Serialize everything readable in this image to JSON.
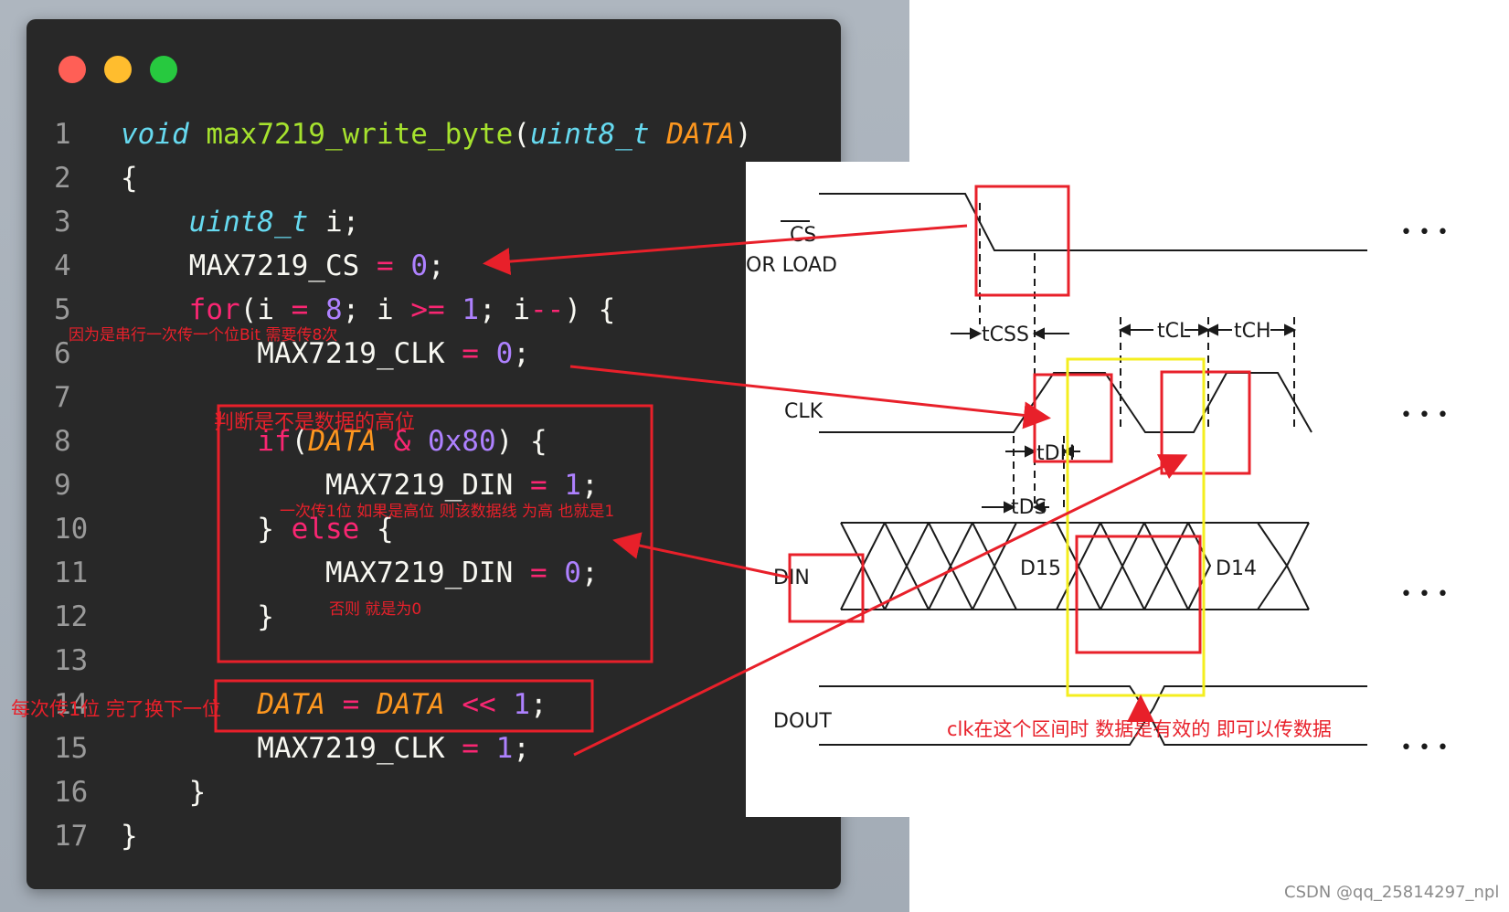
{
  "code": {
    "lines": [
      {
        "num": "1",
        "tokens": [
          [
            "kw-type",
            "void"
          ],
          [
            "plain",
            " "
          ],
          [
            "fn",
            "max7219_write_byte"
          ],
          [
            "plain",
            "("
          ],
          [
            "kw-type",
            "uint8_t"
          ],
          [
            "plain",
            " "
          ],
          [
            "param",
            "DATA"
          ],
          [
            "plain",
            ")"
          ]
        ]
      },
      {
        "num": "2",
        "tokens": [
          [
            "plain",
            "{"
          ]
        ]
      },
      {
        "num": "3",
        "tokens": [
          [
            "plain",
            "    "
          ],
          [
            "kw-type",
            "uint8_t"
          ],
          [
            "plain",
            " i;"
          ]
        ]
      },
      {
        "num": "4",
        "tokens": [
          [
            "plain",
            "    MAX7219_CS "
          ],
          [
            "op",
            "="
          ],
          [
            "plain",
            " "
          ],
          [
            "num",
            "0"
          ],
          [
            "plain",
            ";"
          ]
        ]
      },
      {
        "num": "5",
        "tokens": [
          [
            "plain",
            "    "
          ],
          [
            "kw",
            "for"
          ],
          [
            "plain",
            "(i "
          ],
          [
            "op",
            "="
          ],
          [
            "plain",
            " "
          ],
          [
            "num",
            "8"
          ],
          [
            "plain",
            "; i "
          ],
          [
            "op",
            ">="
          ],
          [
            "plain",
            " "
          ],
          [
            "num",
            "1"
          ],
          [
            "plain",
            "; i"
          ],
          [
            "op",
            "--"
          ],
          [
            "plain",
            ") {"
          ]
        ]
      },
      {
        "num": "6",
        "tokens": [
          [
            "plain",
            "        MAX7219_CLK "
          ],
          [
            "op",
            "="
          ],
          [
            "plain",
            " "
          ],
          [
            "num",
            "0"
          ],
          [
            "plain",
            ";"
          ]
        ]
      },
      {
        "num": "7",
        "tokens": []
      },
      {
        "num": "8",
        "tokens": [
          [
            "plain",
            "        "
          ],
          [
            "kw",
            "if"
          ],
          [
            "plain",
            "("
          ],
          [
            "param",
            "DATA"
          ],
          [
            "plain",
            " "
          ],
          [
            "op",
            "&"
          ],
          [
            "plain",
            " "
          ],
          [
            "num",
            "0x80"
          ],
          [
            "plain",
            ") {"
          ]
        ]
      },
      {
        "num": "9",
        "tokens": [
          [
            "plain",
            "            MAX7219_DIN "
          ],
          [
            "op",
            "="
          ],
          [
            "plain",
            " "
          ],
          [
            "num",
            "1"
          ],
          [
            "plain",
            ";"
          ]
        ]
      },
      {
        "num": "10",
        "tokens": [
          [
            "plain",
            "        } "
          ],
          [
            "kw",
            "else"
          ],
          [
            "plain",
            " {"
          ]
        ]
      },
      {
        "num": "11",
        "tokens": [
          [
            "plain",
            "            MAX7219_DIN "
          ],
          [
            "op",
            "="
          ],
          [
            "plain",
            " "
          ],
          [
            "num",
            "0"
          ],
          [
            "plain",
            ";"
          ]
        ]
      },
      {
        "num": "12",
        "tokens": [
          [
            "plain",
            "        }"
          ]
        ]
      },
      {
        "num": "13",
        "tokens": []
      },
      {
        "num": "14",
        "tokens": [
          [
            "plain",
            "        "
          ],
          [
            "param",
            "DATA"
          ],
          [
            "plain",
            " "
          ],
          [
            "op",
            "="
          ],
          [
            "plain",
            " "
          ],
          [
            "param",
            "DATA"
          ],
          [
            "plain",
            " "
          ],
          [
            "op",
            "<<"
          ],
          [
            "plain",
            " "
          ],
          [
            "num",
            "1"
          ],
          [
            "plain",
            ";"
          ]
        ]
      },
      {
        "num": "15",
        "tokens": [
          [
            "plain",
            "        MAX7219_CLK "
          ],
          [
            "op",
            "="
          ],
          [
            "plain",
            " "
          ],
          [
            "num",
            "1"
          ],
          [
            "plain",
            ";"
          ]
        ]
      },
      {
        "num": "16",
        "tokens": [
          [
            "plain",
            "    }"
          ]
        ]
      },
      {
        "num": "17",
        "tokens": [
          [
            "plain",
            "}"
          ]
        ]
      }
    ]
  },
  "annotations": {
    "serial_note": "因为是串行一次传一个位Bit 需要传8次",
    "high_bit_note": "判断是不是数据的高位",
    "din_high_note": "一次传1位  如果是高位 则该数据线 为高 也就是1",
    "else_note": "否则 就是为0",
    "shift_note": "每次传1位 完了换下一位",
    "clk_valid_note": "clk在这个区间时 数据是有效的 即可以传数据"
  },
  "timing_diagram": {
    "signals": {
      "cs": "CS",
      "or_load": "OR LOAD",
      "clk": "CLK",
      "din": "DIN",
      "dout": "DOUT"
    },
    "timings": {
      "tcss": "tCSS",
      "tcl": "tCL",
      "tch": "tCH",
      "tdh": "tDH",
      "tds": "tDS"
    },
    "data_bits": {
      "d15": "D15",
      "d14": "D14"
    },
    "ellipsis": "• • •"
  },
  "watermark": "CSDN @qq_25814297_npl",
  "colors": {
    "editor_bg": "#282828",
    "annotation_red": "#e8202a",
    "highlight_yellow": "#f4ee1f"
  }
}
